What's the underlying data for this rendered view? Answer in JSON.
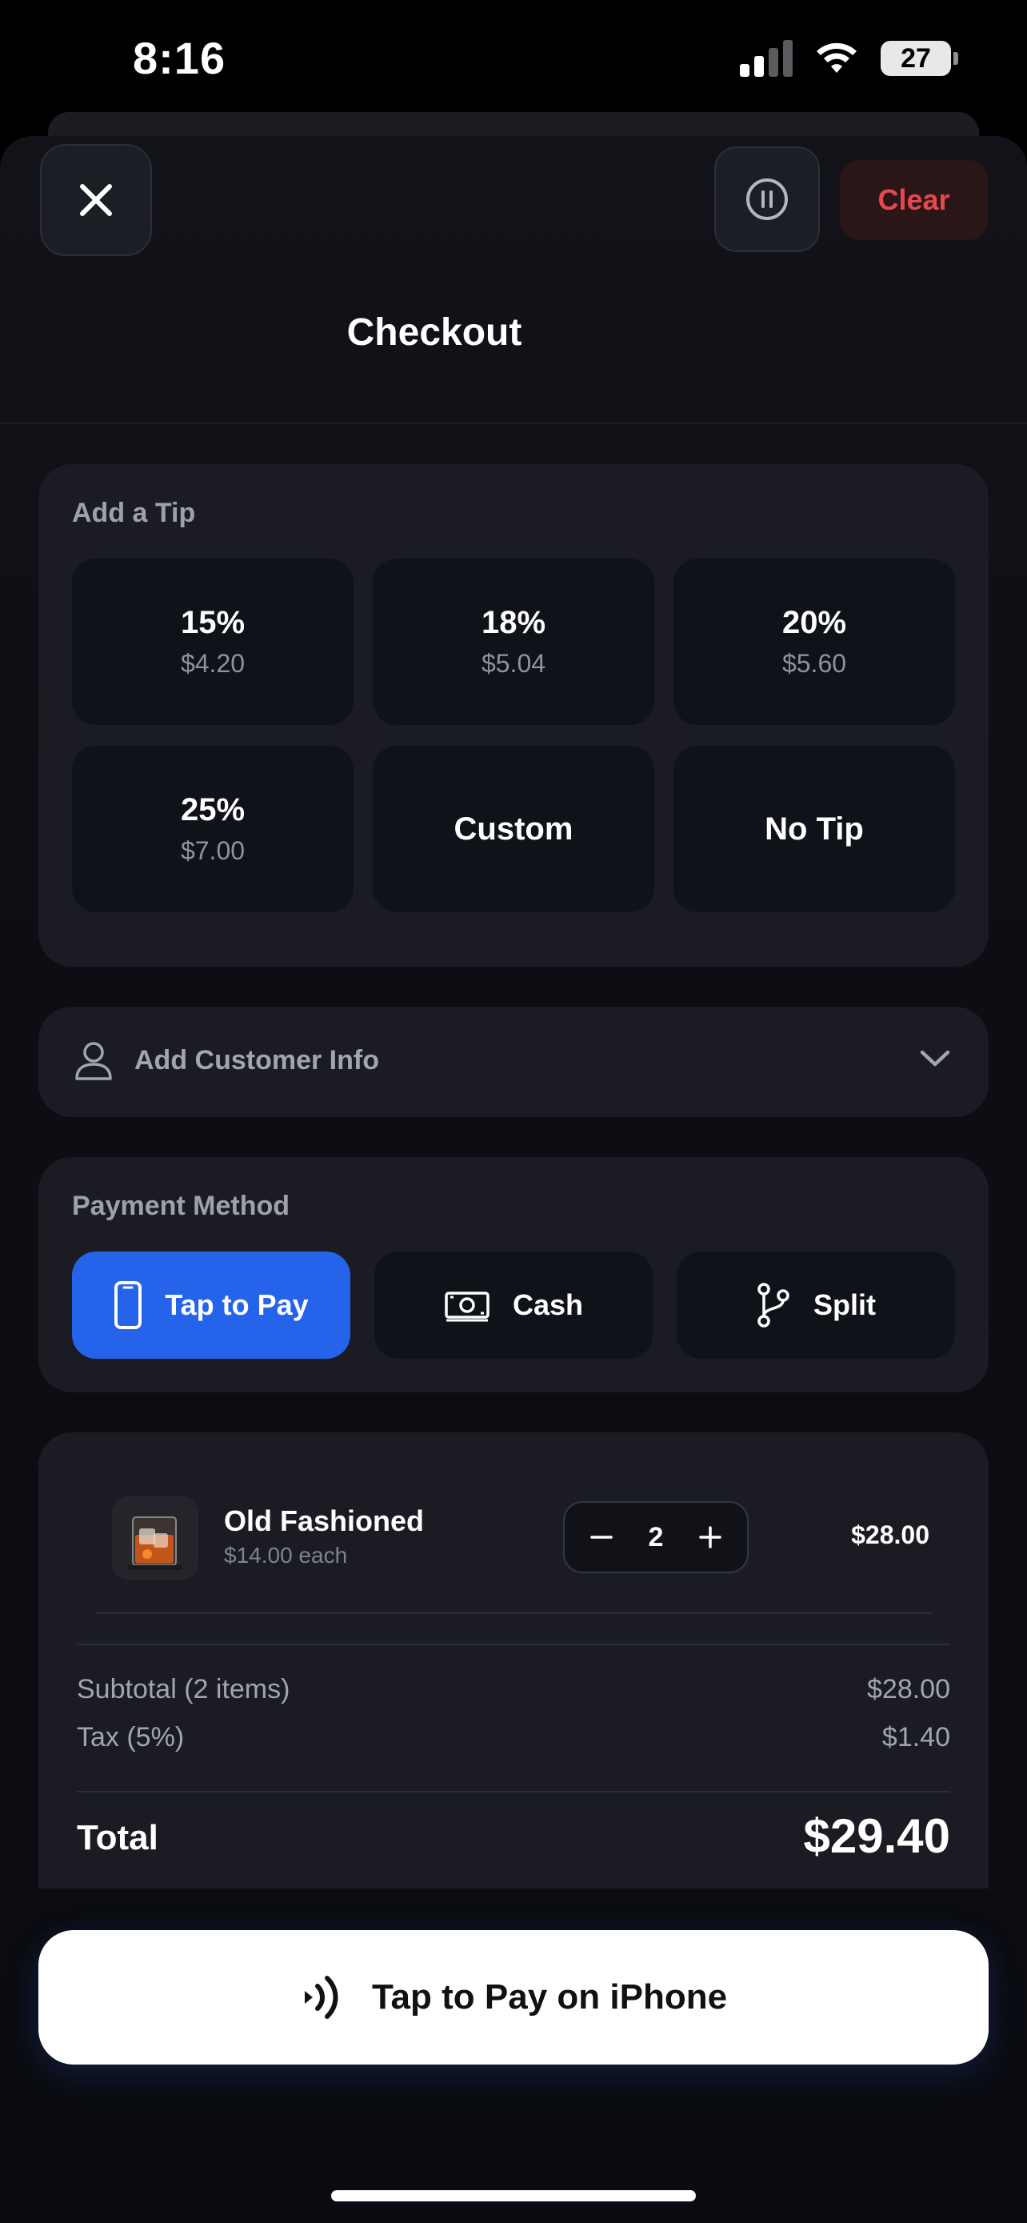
{
  "status_bar": {
    "time": "8:16",
    "battery": "27"
  },
  "header": {
    "title": "Checkout",
    "clear_label": "Clear"
  },
  "tip": {
    "label": "Add a Tip",
    "options": [
      {
        "percent": "15%",
        "amount": "$4.20"
      },
      {
        "percent": "18%",
        "amount": "$5.04"
      },
      {
        "percent": "20%",
        "amount": "$5.60"
      },
      {
        "percent": "25%",
        "amount": "$7.00"
      }
    ],
    "custom_label": "Custom",
    "no_tip_label": "No Tip"
  },
  "customer": {
    "label": "Add Customer Info"
  },
  "payment": {
    "label": "Payment Method",
    "methods": [
      {
        "label": "Tap to Pay",
        "icon": "phone-icon",
        "selected": true
      },
      {
        "label": "Cash",
        "icon": "cash-icon",
        "selected": false
      },
      {
        "label": "Split",
        "icon": "split-icon",
        "selected": false
      }
    ],
    "accent": "#2563eb"
  },
  "order": {
    "items": [
      {
        "name": "Old Fashioned",
        "each": "$14.00 each",
        "quantity": "2",
        "total": "$28.00"
      }
    ],
    "subtotal_label": "Subtotal (2 items)",
    "subtotal_value": "$28.00",
    "tax_label": "Tax (5%)",
    "tax_value": "$1.40",
    "total_label": "Total",
    "total_value": "$29.40"
  },
  "cta": {
    "label": "Tap to Pay on iPhone"
  },
  "colors": {
    "danger": "#e5484d",
    "background": "#0b0c11",
    "card": "#1b1c23"
  }
}
